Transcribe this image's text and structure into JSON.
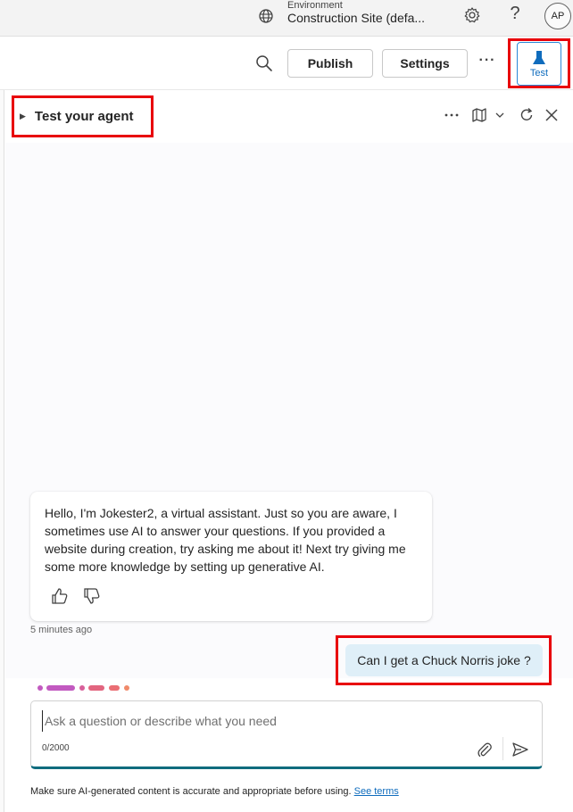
{
  "topbar": {
    "environment_label": "Environment",
    "environment_name": "Construction Site (defa...",
    "help_glyph": "?",
    "avatar_initials": "AP",
    "icons": [
      "globe-icon",
      "gear-icon",
      "help-icon"
    ]
  },
  "toolbar": {
    "publish_label": "Publish",
    "settings_label": "Settings",
    "more_glyph": "···",
    "test_label": "Test",
    "icons": [
      "search-icon",
      "more-icon",
      "flask-icon"
    ]
  },
  "test_panel": {
    "title": "Test your agent",
    "icons": [
      "more-icon",
      "map-icon",
      "chevron-down-icon",
      "refresh-icon",
      "close-icon"
    ]
  },
  "chat": {
    "bot_message": "Hello, I'm Jokester2, a virtual assistant. Just so you are aware, I sometimes use AI to answer your questions. If you provided a website during creation, try asking me about it! Next try giving me some more knowledge by setting up generative AI.",
    "bot_timestamp": "5 minutes ago",
    "user_message": "Can I get a Chuck Norris joke ?",
    "feedback_icons": [
      "thumbs-up-icon",
      "thumbs-down-icon"
    ]
  },
  "input": {
    "placeholder": "Ask a question or describe what you need",
    "char_count": "0/2000",
    "icons": [
      "attach-icon",
      "send-icon"
    ]
  },
  "footer": {
    "disclaimer": "Make sure AI-generated content is accurate and appropriate before using.",
    "see_terms_label": "See terms"
  },
  "colors": {
    "accent": "#0f6cbd",
    "highlight_box": "#e8000b",
    "user_bubble": "#dfeff8",
    "input_underline": "#0f6c7e"
  }
}
